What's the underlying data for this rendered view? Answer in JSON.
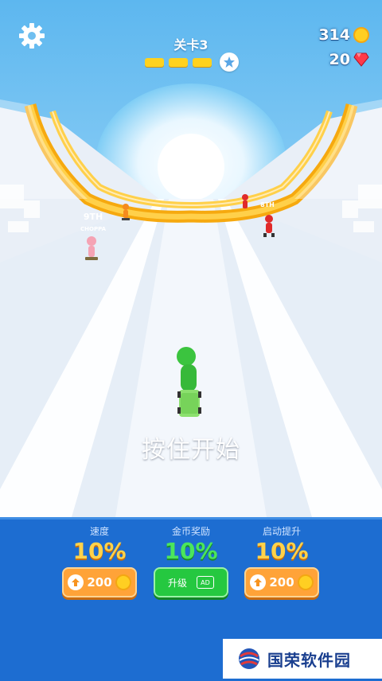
{
  "hud": {
    "level_label": "关卡3",
    "progress_segments": 3,
    "coins": "314",
    "gems": "20"
  },
  "race": {
    "rival_left_rank": "9TH",
    "rival_left_name": "CHOPPA",
    "rival_right_rank": "8TH"
  },
  "prompt": "按住开始",
  "upgrades": [
    {
      "label": "速度",
      "value": "10%",
      "button": "200"
    },
    {
      "label": "金币奖励",
      "value": "10%",
      "button": "升级",
      "ad_label": "AD"
    },
    {
      "label": "启动提升",
      "value": "10%",
      "button": "200"
    }
  ],
  "watermark": "国荣软件园",
  "colors": {
    "sky": "#5fb8ef",
    "track_rail": "#f7b21e",
    "panel": "#1d6dd1",
    "player": "#3bc43f"
  }
}
